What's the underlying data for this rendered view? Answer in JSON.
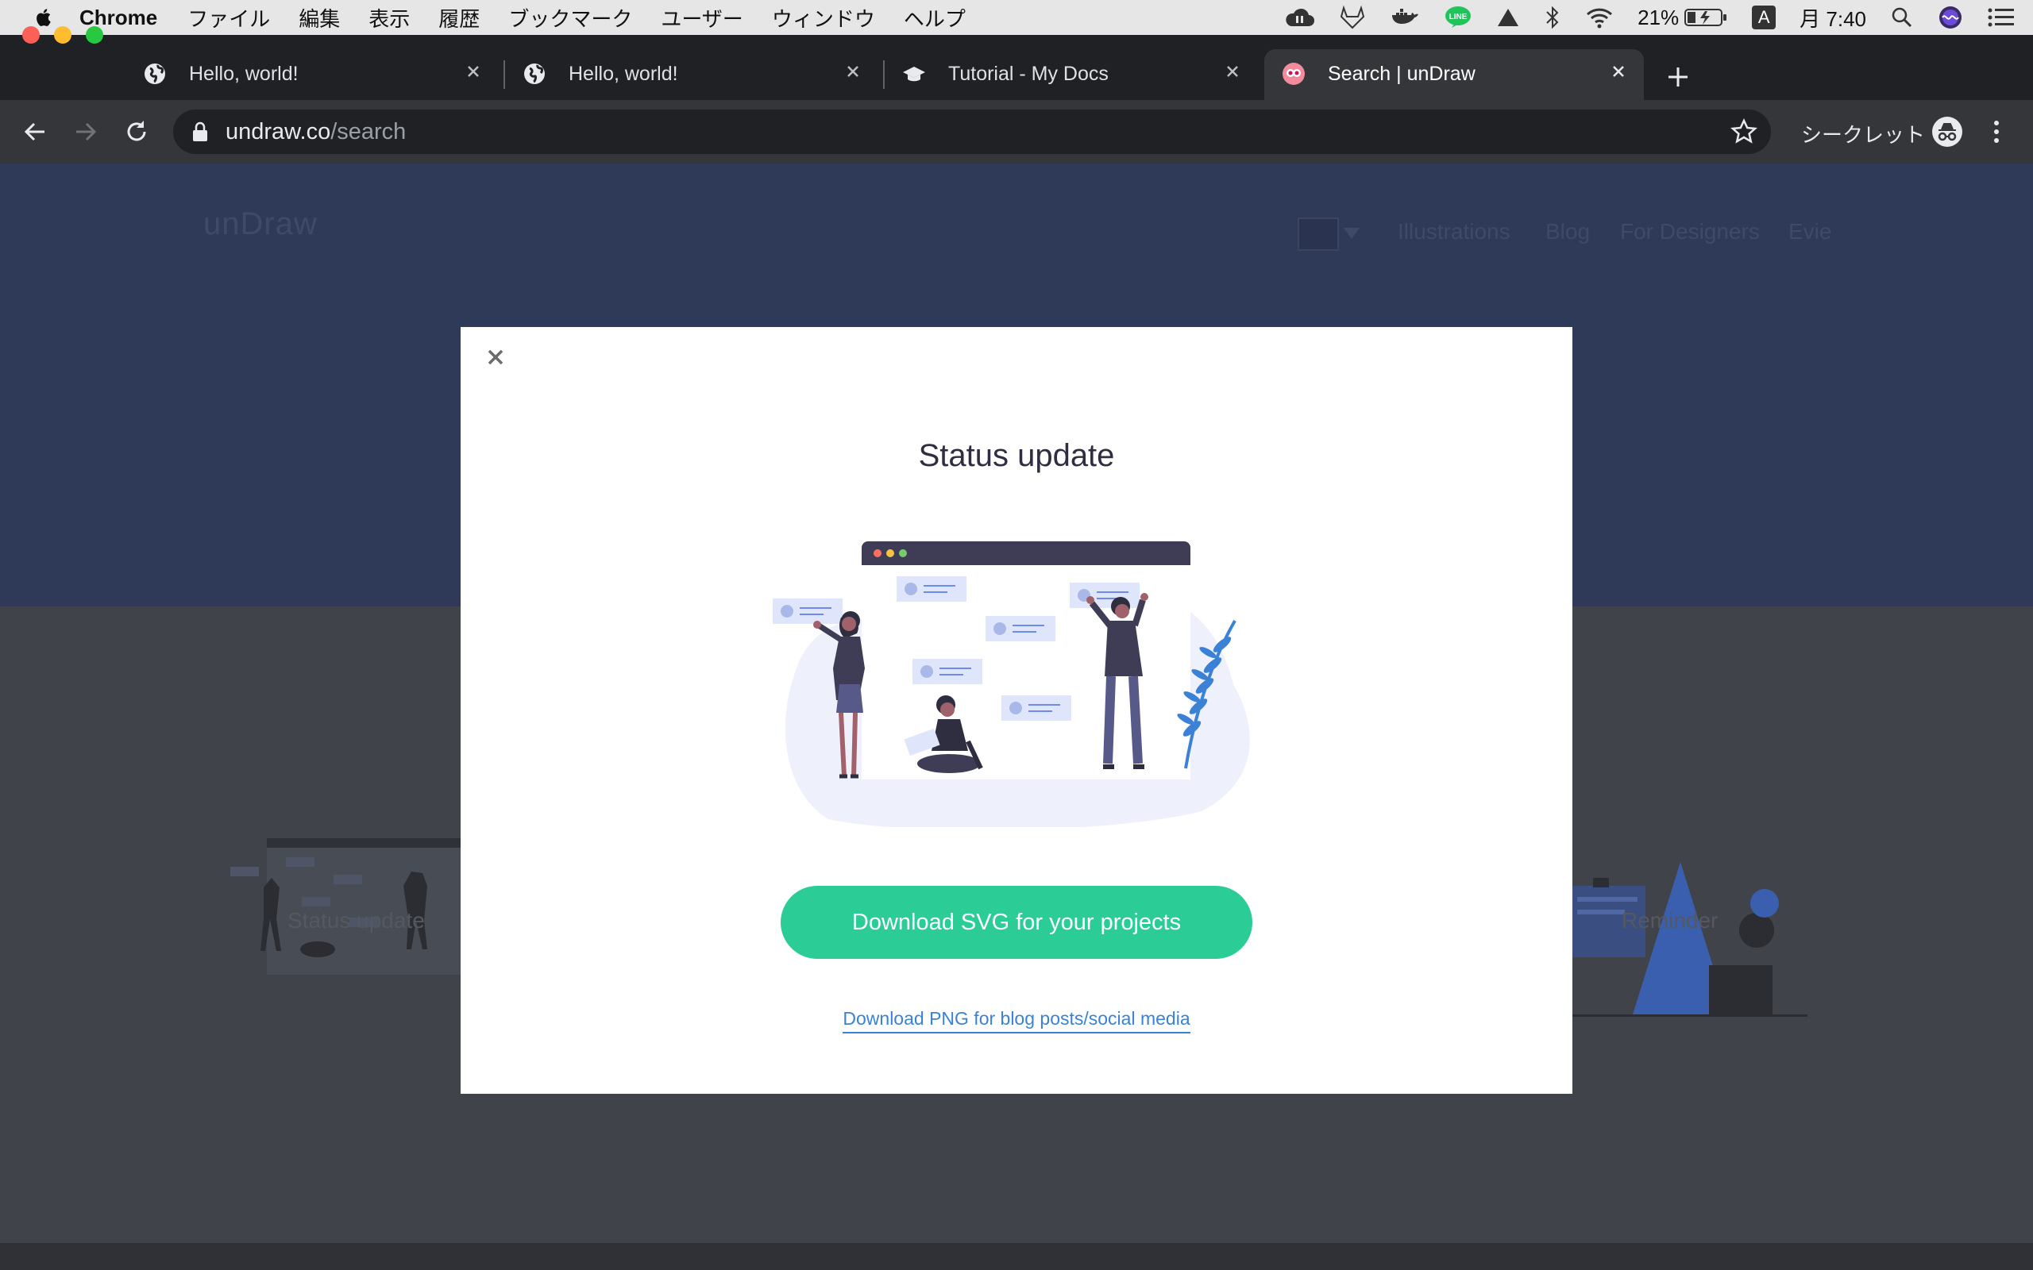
{
  "menubar": {
    "app_name": "Chrome",
    "items": [
      "ファイル",
      "編集",
      "表示",
      "履歴",
      "ブックマーク",
      "ユーザー",
      "ウィンドウ",
      "ヘルプ"
    ],
    "battery": "21%",
    "input_source": "A",
    "clock": "月 7:40"
  },
  "tabs": [
    {
      "title": "Hello, world!",
      "icon": "globe-icon"
    },
    {
      "title": "Hello, world!",
      "icon": "globe-icon"
    },
    {
      "title": "Tutorial - My Docs",
      "icon": "graduation-cap-icon"
    },
    {
      "title": "Search | unDraw",
      "icon": "undraw-favicon-icon",
      "active": true
    }
  ],
  "toolbar": {
    "url_host": "undraw.co",
    "url_path": "/search",
    "incognito_label": "シークレット"
  },
  "site": {
    "logo": "unDraw",
    "nav": [
      "Illustrations",
      "Blog",
      "For Designers",
      "Evie"
    ],
    "cards": [
      "Status update",
      "Reminder"
    ]
  },
  "modal": {
    "title": "Status update",
    "download_svg_label": "Download SVG for your projects",
    "download_png_label": "Download PNG for blog posts/social media"
  },
  "colors": {
    "accent_green": "#2bcc96",
    "link_blue": "#3b82d6",
    "illustration_blue": "#3b82d6",
    "hero_bg": "#2e3a58"
  }
}
